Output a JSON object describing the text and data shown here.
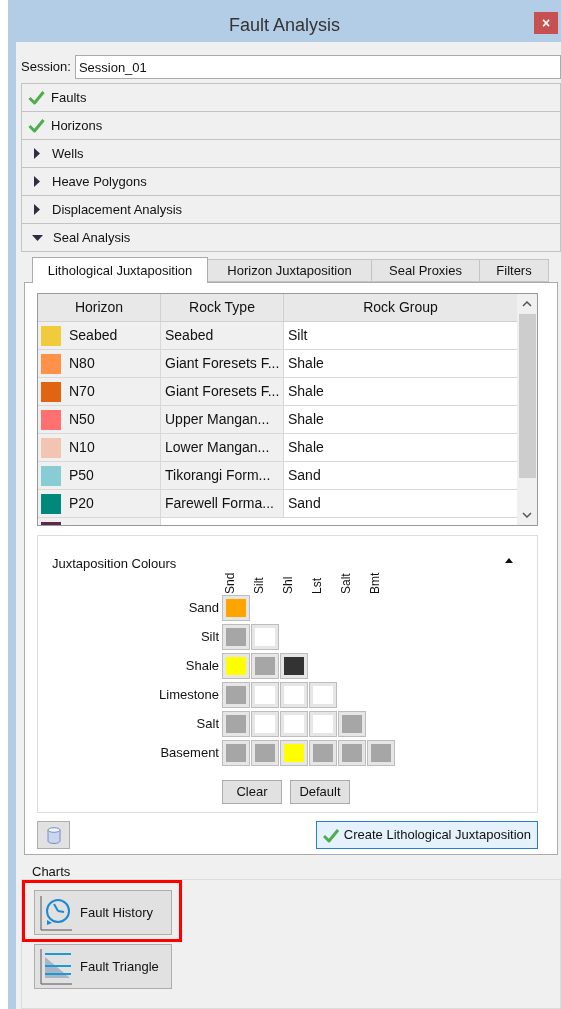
{
  "window": {
    "title": "Fault Analysis",
    "close": "×"
  },
  "session": {
    "label": "Session:",
    "value": "Session_01"
  },
  "sections": [
    {
      "label": "Faults",
      "kind": "done"
    },
    {
      "label": "Horizons",
      "kind": "done"
    },
    {
      "label": "Wells",
      "kind": "pending",
      "expanded": false
    },
    {
      "label": "Heave Polygons",
      "kind": "pending",
      "expanded": false
    },
    {
      "label": "Displacement Analysis",
      "kind": "pending",
      "expanded": false
    },
    {
      "label": "Seal Analysis",
      "kind": "pending",
      "expanded": true
    }
  ],
  "tabs": [
    {
      "label": "Lithological Juxtaposition",
      "selected": true
    },
    {
      "label": "Horizon Juxtaposition",
      "selected": false
    },
    {
      "label": "Seal Proxies",
      "selected": false
    },
    {
      "label": "Filters",
      "selected": false
    }
  ],
  "table": {
    "columns": [
      "Horizon",
      "Rock Type",
      "Rock Group"
    ],
    "rows": [
      {
        "color": "#f0cc3c",
        "horizon": "Seabed",
        "rock_type": "Seabed",
        "rock_group": "Silt"
      },
      {
        "color": "#ff9148",
        "horizon": "N80",
        "rock_type": "Giant Foresets F...",
        "rock_group": "Shale"
      },
      {
        "color": "#e06412",
        "horizon": "N70",
        "rock_type": "Giant Foresets F...",
        "rock_group": "Shale"
      },
      {
        "color": "#ff7070",
        "horizon": "N50",
        "rock_type": "Upper Mangan...",
        "rock_group": "Shale"
      },
      {
        "color": "#f4c4b2",
        "horizon": "N10",
        "rock_type": "Lower Mangan...",
        "rock_group": "Shale"
      },
      {
        "color": "#88ccd4",
        "horizon": "P50",
        "rock_type": "Tikorangi Form...",
        "rock_group": "Sand"
      },
      {
        "color": "#00897a",
        "horizon": "P20",
        "rock_type": "Farewell Forma...",
        "rock_group": "Sand"
      },
      {
        "color": "#5c2a48"
      }
    ]
  },
  "juxtaposition": {
    "title": "Juxtaposition Colours",
    "expanded": true,
    "columns": [
      "Snd",
      "Silt",
      "Shl",
      "Lst",
      "Salt",
      "Bmt"
    ],
    "rows": [
      {
        "label": "Sand",
        "cells": [
          {
            "color": "#ffa500"
          }
        ]
      },
      {
        "label": "Silt",
        "cells": [
          {
            "color": "#a6a6a6"
          },
          {
            "color": "#ffffff"
          }
        ]
      },
      {
        "label": "Shale",
        "cells": [
          {
            "color": "#ffff00"
          },
          {
            "color": "#a6a6a6"
          },
          {
            "color": "#333333"
          }
        ]
      },
      {
        "label": "Limestone",
        "cells": [
          {
            "color": "#a6a6a6"
          },
          {
            "color": "#ffffff"
          },
          {
            "color": "#ffffff"
          },
          {
            "color": "#ffffff"
          }
        ]
      },
      {
        "label": "Salt",
        "cells": [
          {
            "color": "#a6a6a6"
          },
          {
            "color": "#ffffff"
          },
          {
            "color": "#ffffff"
          },
          {
            "color": "#ffffff"
          },
          {
            "color": "#a6a6a6"
          }
        ]
      },
      {
        "label": "Basement",
        "cells": [
          {
            "color": "#a6a6a6"
          },
          {
            "color": "#a6a6a6"
          },
          {
            "color": "#ffff00"
          },
          {
            "color": "#a6a6a6"
          },
          {
            "color": "#a6a6a6"
          },
          {
            "color": "#a6a6a6"
          }
        ]
      }
    ],
    "buttons": [
      "Clear",
      "Default"
    ]
  },
  "create_button": "Create Lithological Juxtaposition",
  "charts": {
    "label": "Charts",
    "buttons": [
      {
        "label": "Fault History",
        "kind": "history",
        "highlighted": true
      },
      {
        "label": "Fault Triangle",
        "kind": "triangle",
        "highlighted": false
      }
    ]
  }
}
